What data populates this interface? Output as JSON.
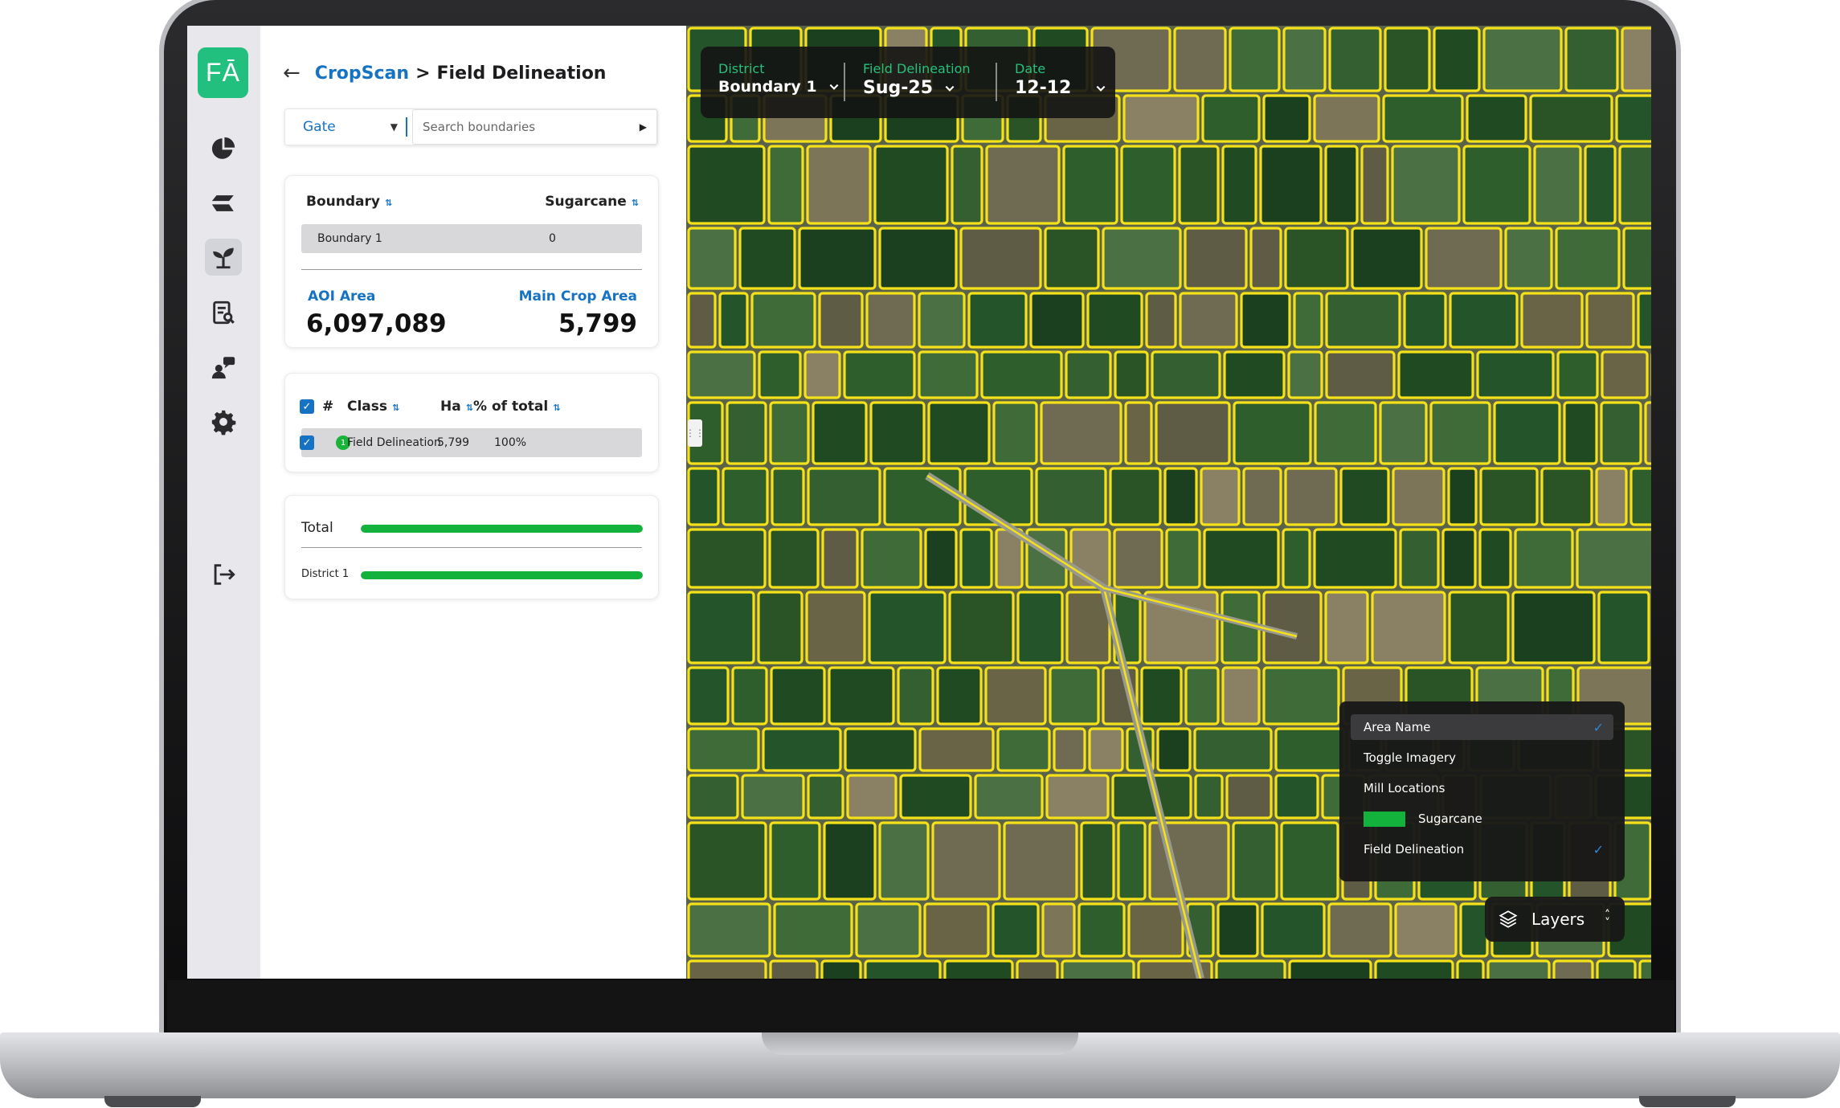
{
  "brand": {
    "logo_text": "FĀ",
    "accent": "#22c07e"
  },
  "breadcrumb": {
    "back_icon": "arrow-left-icon",
    "app": "CropScan",
    "separator": ">",
    "page": "Field Delineation"
  },
  "filter": {
    "gate_label": "Gate",
    "search_placeholder": "Search boundaries"
  },
  "boundary_card": {
    "headers": [
      "Boundary",
      "Sugarcane"
    ],
    "rows": [
      {
        "name": "Boundary 1",
        "value": "0"
      }
    ],
    "aoi_label": "AOI Area",
    "aoi_value": "6,097,089",
    "main_crop_label": "Main Crop Area",
    "main_crop_value": "5,799"
  },
  "class_table": {
    "headers": {
      "num": "#",
      "class": "Class",
      "ha": "Ha",
      "pct": "% of total"
    },
    "rows": [
      {
        "num": "1",
        "class": "Field Delineation",
        "ha": "5,799",
        "pct": "100%"
      }
    ]
  },
  "totals": {
    "items": [
      {
        "label": "Total",
        "fraction": 1.0
      },
      {
        "label": "District 1",
        "fraction": 1.0
      }
    ],
    "bar_color": "#12b23c"
  },
  "map_toolbar": {
    "district": {
      "label": "District",
      "value": "Boundary 1"
    },
    "delineation": {
      "label": "Field Delineation",
      "value": "Sug-25"
    },
    "date": {
      "label": "Date",
      "value": "12-12"
    }
  },
  "layers_menu": {
    "items": [
      {
        "label": "Area Name",
        "checked": true,
        "highlighted": true
      },
      {
        "label": "Toggle Imagery",
        "checked": false
      },
      {
        "label": "Mill Locations",
        "checked": false
      },
      {
        "label": "Sugarcane",
        "checked": false,
        "swatch": "#12b23c"
      },
      {
        "label": "Field Delineation",
        "checked": true
      }
    ],
    "button_label": "Layers"
  },
  "field_outline_color": "#f5e11a"
}
